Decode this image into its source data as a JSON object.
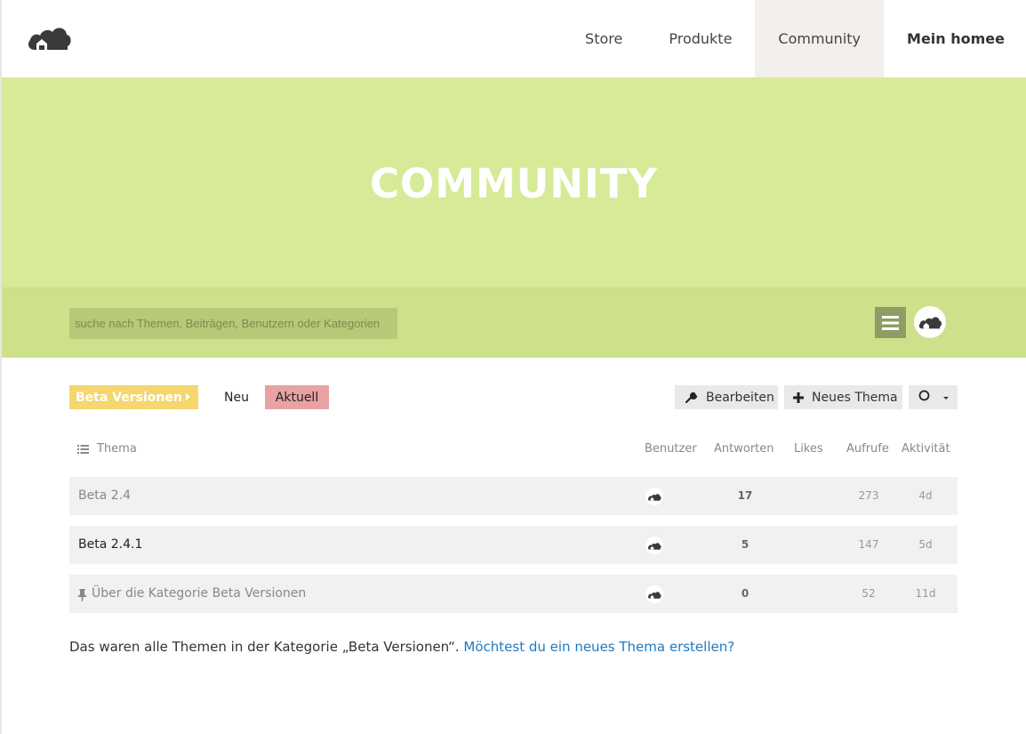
{
  "header": {
    "logo_icon": "cloud-house-logo",
    "nav": [
      {
        "label": "Store"
      },
      {
        "label": "Produkte"
      },
      {
        "label": "Community"
      },
      {
        "label": "Mein homee"
      }
    ]
  },
  "hero": {
    "title": "COMMUNITY",
    "bg_color": "#d6ea98"
  },
  "search": {
    "placeholder": "suche nach Themen, Beiträgen, Benutzern oder Kategorien"
  },
  "toolbar": {
    "category": "Beta Versionen",
    "tab_new": "Neu",
    "tab_current": "Aktuell",
    "edit_label": "Bearbeiten",
    "new_topic_label": "Neues Thema"
  },
  "table": {
    "headers": {
      "topic": "Thema",
      "users": "Benutzer",
      "replies": "Antworten",
      "likes": "Likes",
      "views": "Aufrufe",
      "activity": "Aktivität"
    },
    "rows": [
      {
        "title": "Beta 2.4",
        "replies": "17",
        "views": "273",
        "activity": "4d"
      },
      {
        "title": "Beta 2.4.1",
        "replies": "5",
        "views": "147",
        "activity": "5d"
      },
      {
        "title": "Über die Kategorie Beta Versionen",
        "replies": "0",
        "views": "52",
        "activity": "11d"
      }
    ]
  },
  "footer": {
    "text": "Das waren alle Themen in der Kategorie „Beta Versionen“. ",
    "link": "Möchtest du ein neues Thema erstellen?"
  },
  "colors": {
    "accent_green": "#cde08a",
    "category_yellow": "#f5d66f",
    "current_pink": "#e8a2a2",
    "link_blue": "#1e7ac4"
  }
}
